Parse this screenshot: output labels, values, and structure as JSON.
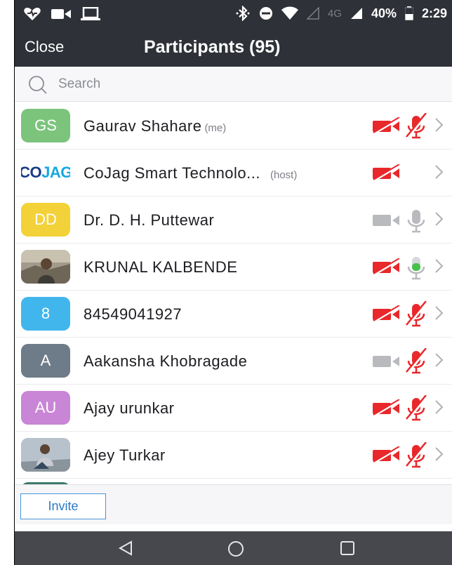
{
  "status_bar": {
    "network_label": "4G",
    "battery": "40%",
    "time": "2:29"
  },
  "header": {
    "close_label": "Close",
    "title": "Participants (95)"
  },
  "search": {
    "placeholder": "Search"
  },
  "participants": [
    {
      "initials": "GS",
      "name": "Gaurav Shahare",
      "tag": "(me)",
      "avatar_color": "#7cc47c",
      "video": "off",
      "audio": "muted"
    },
    {
      "initials": "",
      "logo": [
        "CO",
        "JAG"
      ],
      "name": "CoJag Smart Technolo...",
      "tag": "(host)",
      "avatar_color": "#ffffff",
      "video": "off",
      "audio": "none"
    },
    {
      "initials": "DD",
      "name": "Dr. D. H. Puttewar",
      "tag": "",
      "avatar_color": "#f3d138",
      "video": "disabled",
      "audio": "disabled"
    },
    {
      "initials": "",
      "photo": true,
      "name": "KRUNAL KALBENDE",
      "tag": "",
      "avatar_color": "#8d8678",
      "video": "off",
      "audio": "active"
    },
    {
      "initials": "8",
      "name": "84549041927",
      "tag": "",
      "avatar_color": "#41b6ec",
      "video": "off",
      "audio": "muted"
    },
    {
      "initials": "A",
      "name": "Aakansha Khobragade",
      "tag": "",
      "avatar_color": "#6e7b88",
      "video": "disabled",
      "audio": "muted"
    },
    {
      "initials": "AU",
      "name": "Ajay urunkar",
      "tag": "",
      "avatar_color": "#c985d6",
      "video": "off",
      "audio": "muted"
    },
    {
      "initials": "",
      "photo": true,
      "name": "Ajey Turkar",
      "tag": "",
      "avatar_color": "#9aa7b5",
      "video": "off",
      "audio": "muted"
    }
  ],
  "footer": {
    "invite_label": "Invite"
  },
  "colors": {
    "header_bg": "#2f3138",
    "muted_red": "#e8282b",
    "active_green": "#47c04c",
    "disabled_gray": "#b9babe",
    "accent_blue": "#2d7bc6"
  }
}
